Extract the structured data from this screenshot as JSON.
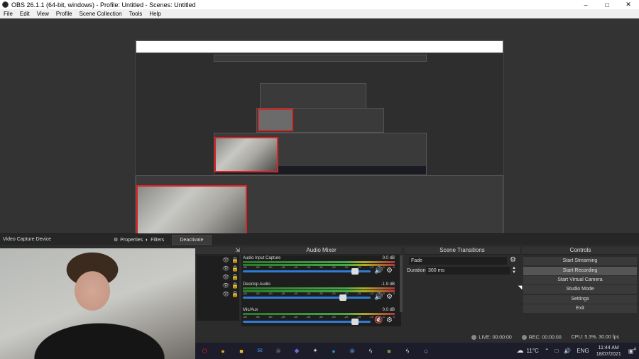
{
  "window": {
    "title": "OBS 26.1.1 (64-bit, windows) - Profile: Untitled - Scenes: Untitled",
    "minimize": "–",
    "maximize": "□",
    "close": "✕"
  },
  "menu": [
    "File",
    "Edit",
    "View",
    "Profile",
    "Scene Collection",
    "Tools",
    "Help"
  ],
  "source_toolbar": {
    "source_name": "Video Capture Device",
    "properties": "Properties",
    "filters": "Filters",
    "deactivate": "Deactivate"
  },
  "mixer": {
    "title": "Audio Mixer",
    "tracks": [
      {
        "name": "Audio Input Capture",
        "db": "0.0 dB",
        "level": 0.9,
        "muted": false
      },
      {
        "name": "Desktop Audio",
        "db": "-1.9 dB",
        "level": 0.8,
        "muted": false
      },
      {
        "name": "Mic/Aux",
        "db": "0.0 dB",
        "level": 0.9,
        "muted": true
      }
    ],
    "ticks": [
      "-60",
      "-55",
      "-50",
      "-45",
      "-40",
      "-35",
      "-30",
      "-25",
      "-20",
      "-15",
      "-10",
      "-5",
      "0"
    ]
  },
  "transitions": {
    "title": "Scene Transitions",
    "selected": "Fade",
    "duration_label": "Duration",
    "duration_value": "300 ms"
  },
  "controls": {
    "title": "Controls",
    "buttons": [
      "Start Streaming",
      "Start Recording",
      "Start Virtual Camera",
      "Studio Mode",
      "Settings",
      "Exit"
    ]
  },
  "status": {
    "live": "LIVE: 00:00:00",
    "rec": "REC: 00:00:00",
    "cpu": "CPU: 5.3%, 30.00 fps"
  },
  "taskbar": {
    "weather": "11°C",
    "lang": "ENG",
    "time": "11:44 AM",
    "date": "18/07/2021",
    "notifications": "4",
    "icons": [
      {
        "name": "opera-icon",
        "glyph": "O",
        "color": "#c9152b"
      },
      {
        "name": "chrome-icon",
        "glyph": "●",
        "color": "#e4a22b"
      },
      {
        "name": "file-explorer-icon",
        "glyph": "■",
        "color": "#e8b731"
      },
      {
        "name": "mail-icon",
        "glyph": "✉",
        "color": "#3d8ad9"
      },
      {
        "name": "obs-icon",
        "glyph": "◉",
        "color": "#555555"
      },
      {
        "name": "app-icon",
        "glyph": "◆",
        "color": "#6a6ad0"
      },
      {
        "name": "visual-studio-icon",
        "glyph": "✦",
        "color": "#cfcfcf"
      },
      {
        "name": "app-icon-2",
        "glyph": "●",
        "color": "#2e86c1"
      },
      {
        "name": "steam-icon",
        "glyph": "◉",
        "color": "#3f6f9c"
      },
      {
        "name": "lightning-icon",
        "glyph": "ϟ",
        "color": "#dddddd"
      },
      {
        "name": "minecraft-icon",
        "glyph": "■",
        "color": "#5f9a3d"
      },
      {
        "name": "lightning-icon-2",
        "glyph": "ϟ",
        "color": "#dddddd"
      },
      {
        "name": "discord-icon",
        "glyph": "☺",
        "color": "#7289da"
      }
    ]
  }
}
